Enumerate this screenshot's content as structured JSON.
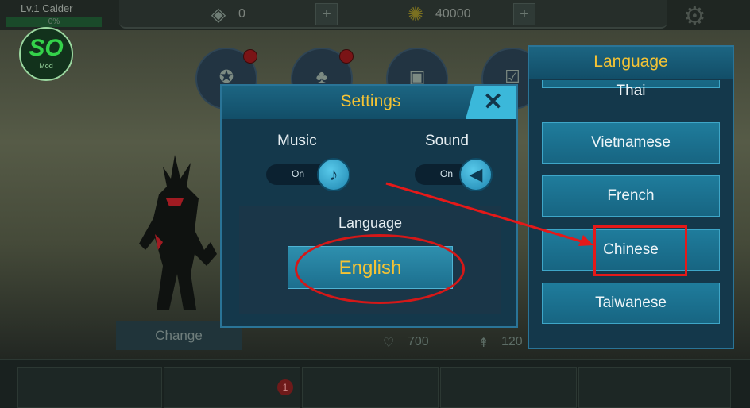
{
  "hud": {
    "level": "Lv.1 Calder",
    "xp": "0%",
    "gems": "0",
    "coins": "40000",
    "plus": "+"
  },
  "logo": {
    "big": "SO",
    "small": "Mod"
  },
  "change_label": "Change",
  "stats": {
    "hearts": "700",
    "power": "120"
  },
  "nav_badge": "1",
  "settings": {
    "title": "Settings",
    "close": "✕",
    "music_label": "Music",
    "sound_label": "Sound",
    "music_state": "On",
    "sound_state": "On",
    "language_label": "Language",
    "language_value": "English"
  },
  "language_dialog": {
    "title": "Language",
    "items": [
      "Thai",
      "Vietnamese",
      "French",
      "Chinese",
      "Taiwanese"
    ]
  },
  "colors": {
    "accent": "#f5c334",
    "highlight": "#e51919"
  }
}
